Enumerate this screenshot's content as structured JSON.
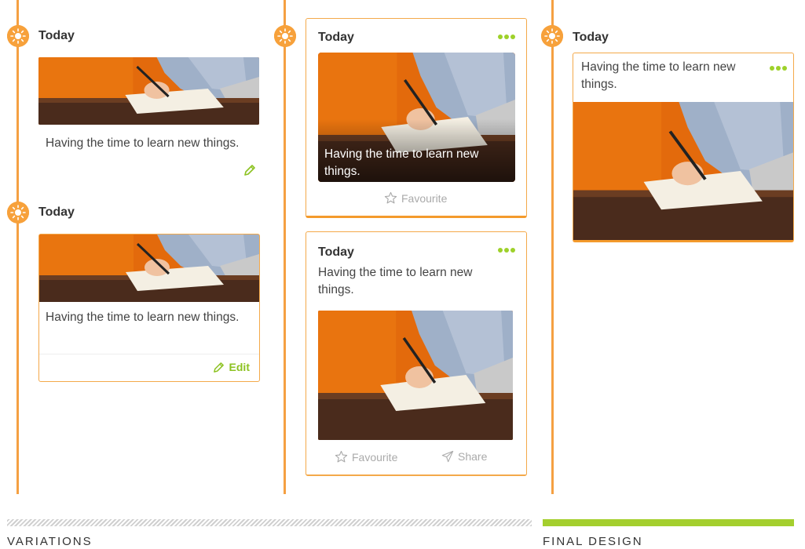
{
  "colors": {
    "timeline": "#f5a042",
    "accent_green": "#9ed12a",
    "card_border": "#f4a94a"
  },
  "variations": {
    "col1": {
      "item1": {
        "date": "Today",
        "caption": "Having the time to learn new things.",
        "edit_icon": "pencil-icon"
      },
      "item2": {
        "date": "Today",
        "caption": "Having the time to learn new things.",
        "edit_label": "Edit"
      }
    },
    "col2": {
      "card1": {
        "date": "Today",
        "caption": "Having the time to learn new things.",
        "favourite_label": "Favourite"
      },
      "card2": {
        "date": "Today",
        "caption": "Having the time to learn new things.",
        "favourite_label": "Favourite",
        "share_label": "Share"
      }
    }
  },
  "final": {
    "card": {
      "date": "Today",
      "caption": "Having the time to learn new things."
    }
  },
  "footer": {
    "variations_label": "VARIATIONS",
    "final_label": "FINAL DESIGN"
  }
}
